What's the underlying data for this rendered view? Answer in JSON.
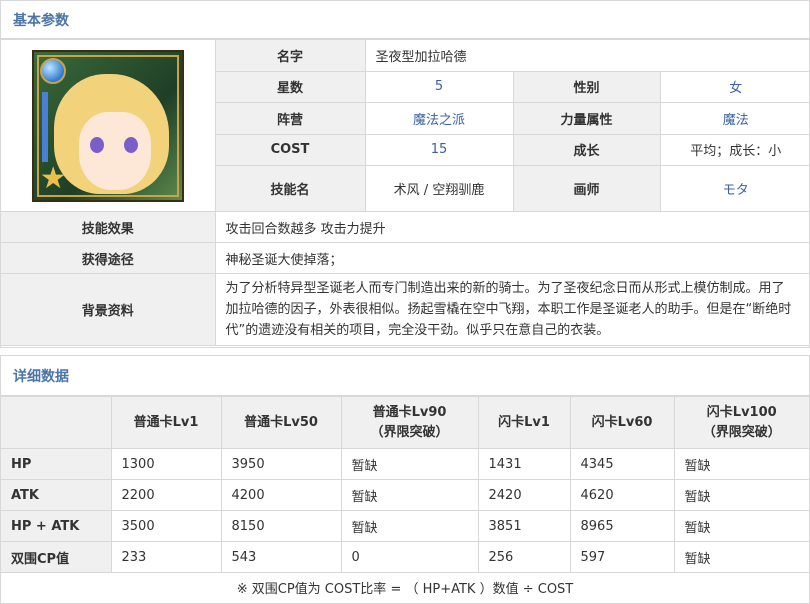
{
  "basic": {
    "title": "基本参数",
    "name_label": "名字",
    "name_value": "圣夜型加拉哈德",
    "stars_label": "星数",
    "stars_value": "5",
    "gender_label": "性别",
    "gender_value": "女",
    "camp_label": "阵营",
    "camp_value": "魔法之派",
    "power_label": "力量属性",
    "power_value": "魔法",
    "cost_label": "COST",
    "cost_value": "15",
    "growth_label": "成长",
    "growth_value": "平均；成长：小",
    "skill_label": "技能名",
    "skill_value": "术风 / 空翔驯鹿",
    "artist_label": "画师",
    "artist_value": "モタ",
    "effect_label": "技能效果",
    "effect_value": "攻击回合数越多 攻击力提升",
    "obtain_label": "获得途径",
    "obtain_value": "神秘圣诞大使掉落；",
    "bg_label": "背景资料",
    "bg_value": "为了分析特异型圣诞老人而专门制造出来的新的骑士。为了圣夜纪念日而从形式上模仿制成。用了加拉哈德的因子，外表很相似。扬起雪橇在空中飞翔，本职工作是圣诞老人的助手。但是在“断绝时代”的遗迹没有相关的项目，完全没干劲。似乎只在意自己的衣装。"
  },
  "detail": {
    "title": "详细数据",
    "columns": [
      {
        "line1": "普通卡Lv1",
        "line2": ""
      },
      {
        "line1": "普通卡Lv50",
        "line2": ""
      },
      {
        "line1": "普通卡Lv90",
        "line2": "（界限突破）"
      },
      {
        "line1": "闪卡Lv1",
        "line2": ""
      },
      {
        "line1": "闪卡Lv60",
        "line2": ""
      },
      {
        "line1": "闪卡Lv100",
        "line2": "（界限突破）"
      }
    ],
    "rows": [
      {
        "label": "HP",
        "values": [
          "1300",
          "3950",
          "暂缺",
          "1431",
          "4345",
          "暂缺"
        ]
      },
      {
        "label": "ATK",
        "values": [
          "2200",
          "4200",
          "暂缺",
          "2420",
          "4620",
          "暂缺"
        ]
      },
      {
        "label": "HP + ATK",
        "values": [
          "3500",
          "8150",
          "暂缺",
          "3851",
          "8965",
          "暂缺"
        ]
      },
      {
        "label": "双围CP值",
        "values": [
          "233",
          "543",
          "0",
          "256",
          "597",
          "暂缺"
        ]
      }
    ],
    "note": "※ 双围CP值为 COST比率 = （ HP+ATK ）数值 ÷ COST"
  },
  "icons": {
    "portrait": "character-portrait-icon"
  }
}
